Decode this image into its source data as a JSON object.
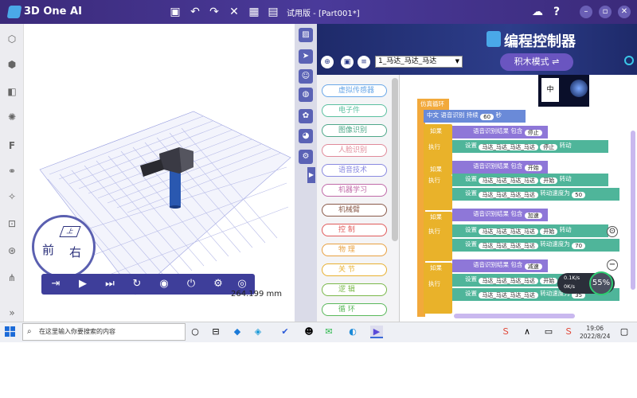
{
  "app": {
    "name": "3D One AI",
    "document_title": "试用版 - [Part001*]"
  },
  "toolbar": {
    "icons": [
      "save-icon",
      "undo-icon",
      "redo-icon",
      "close-icon",
      "grid-icon",
      "clipboard-icon"
    ]
  },
  "window": {
    "icons": [
      "cloud-user-icon",
      "help-icon",
      "minimize-icon",
      "maximize-icon",
      "close-icon"
    ]
  },
  "viewcube": {
    "front": "前",
    "right": "右",
    "top": "上"
  },
  "viewport": {
    "dimension": "264.199 mm"
  },
  "panel": {
    "title": "编程控制器",
    "select_value": "1_马达_马达_马达",
    "block_mode_label": "积木模式 ⇌",
    "categories": [
      "虚拟传感器",
      "电子件",
      "图像识别",
      "人脸识别",
      "语音技术",
      "机器学习",
      "机械臂",
      "控 制",
      "物 理",
      "关 节",
      "逻 辑",
      "循 环"
    ],
    "category_colors": [
      "#6aa8e8",
      "#5bc0a0",
      "#4fa88a",
      "#e08a9a",
      "#8a8ae0",
      "#c06aa8",
      "#8a5a4a",
      "#e05a5a",
      "#e8a040",
      "#e8b030",
      "#7ab84a",
      "#5ab85a"
    ]
  },
  "blocks": {
    "loop": "仿真循环",
    "lang_row": {
      "prefix": "中文",
      "label": "语音识别",
      "timeout_label": "持续",
      "timeout": "60",
      "unit": "秒"
    },
    "if_label": "如果",
    "do_label": "执行",
    "cond_prefix": "语音识别结果",
    "cond_op": "包含",
    "conds": [
      "停止",
      "开始",
      "加速",
      "减速"
    ],
    "set_label": "设置",
    "motor": "马达_马达_马达_马达",
    "actions": [
      "停止",
      "开始",
      "开始"
    ],
    "action_suffix": "转动",
    "speed_label": "转动速度为",
    "speeds": [
      "50",
      "70",
      "35"
    ]
  },
  "perf": {
    "percent": "55%",
    "up": "0.1K/s",
    "down": "0K/s"
  },
  "taskbar": {
    "search_placeholder": "在这里输入你要搜索的内容",
    "time": "19:06",
    "date": "2022/8/24"
  }
}
